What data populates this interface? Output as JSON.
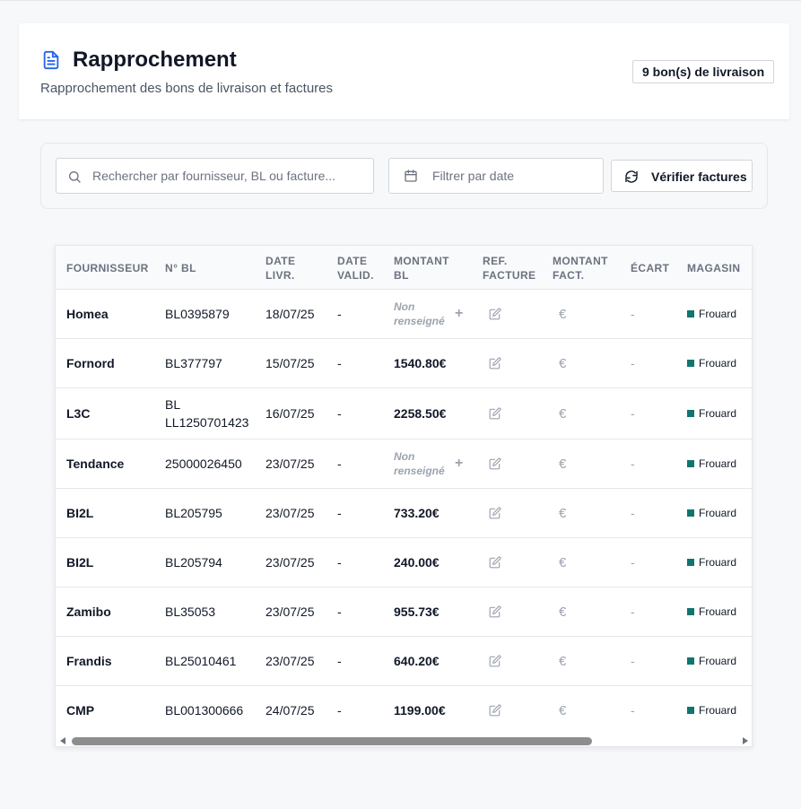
{
  "header": {
    "title": "Rapprochement",
    "subtitle": "Rapprochement des bons de livraison et factures",
    "badge": "9 bon(s) de livraison"
  },
  "filters": {
    "search_placeholder": "Rechercher par fournisseur, BL ou facture...",
    "date_placeholder": "Filtrer par date",
    "verify_label": "Vérifier factures"
  },
  "table": {
    "columns": [
      {
        "line1": "FOURNISSEUR",
        "line2": ""
      },
      {
        "line1": "N° BL",
        "line2": ""
      },
      {
        "line1": "DATE",
        "line2": "LIVR."
      },
      {
        "line1": "DATE",
        "line2": "VALID."
      },
      {
        "line1": "MONTANT",
        "line2": "BL"
      },
      {
        "line1": "REF.",
        "line2": "FACTURE"
      },
      {
        "line1": "MONTANT",
        "line2": "FACT."
      },
      {
        "line1": "ÉCART",
        "line2": ""
      },
      {
        "line1": "MAGASIN",
        "line2": ""
      }
    ],
    "empty_amount": {
      "line1": "Non",
      "line2": "renseigné"
    },
    "add_symbol": "+",
    "euro_symbol": "€",
    "dash": "-",
    "rows": [
      {
        "supplier": "Homea",
        "bl_line1": "BL0395879",
        "bl_line2": "",
        "date_livr": "18/07/25",
        "date_valid": "-",
        "amount": "",
        "ecart": "-",
        "store": "Frouard"
      },
      {
        "supplier": "Fornord",
        "bl_line1": "BL377797",
        "bl_line2": "",
        "date_livr": "15/07/25",
        "date_valid": "-",
        "amount": "1540.80€",
        "ecart": "-",
        "store": "Frouard"
      },
      {
        "supplier": "L3C",
        "bl_line1": "BL",
        "bl_line2": "LL1250701423",
        "date_livr": "16/07/25",
        "date_valid": "-",
        "amount": "2258.50€",
        "ecart": "-",
        "store": "Frouard"
      },
      {
        "supplier": "Tendance",
        "bl_line1": "25000026450",
        "bl_line2": "",
        "date_livr": "23/07/25",
        "date_valid": "-",
        "amount": "",
        "ecart": "-",
        "store": "Frouard"
      },
      {
        "supplier": "BI2L",
        "bl_line1": "BL205795",
        "bl_line2": "",
        "date_livr": "23/07/25",
        "date_valid": "-",
        "amount": "733.20€",
        "ecart": "-",
        "store": "Frouard"
      },
      {
        "supplier": "BI2L",
        "bl_line1": "BL205794",
        "bl_line2": "",
        "date_livr": "23/07/25",
        "date_valid": "-",
        "amount": "240.00€",
        "ecart": "-",
        "store": "Frouard"
      },
      {
        "supplier": "Zamibo",
        "bl_line1": "BL35053",
        "bl_line2": "",
        "date_livr": "23/07/25",
        "date_valid": "-",
        "amount": "955.73€",
        "ecart": "-",
        "store": "Frouard"
      },
      {
        "supplier": "Frandis",
        "bl_line1": "BL25010461",
        "bl_line2": "",
        "date_livr": "23/07/25",
        "date_valid": "-",
        "amount": "640.20€",
        "ecart": "-",
        "store": "Frouard"
      },
      {
        "supplier": "CMP",
        "bl_line1": "BL001300666",
        "bl_line2": "",
        "date_livr": "24/07/25",
        "date_valid": "-",
        "amount": "1199.00€",
        "ecart": "-",
        "store": "Frouard"
      }
    ]
  },
  "colors": {
    "accent": "#2563eb",
    "store_badge": "#0f766e"
  }
}
